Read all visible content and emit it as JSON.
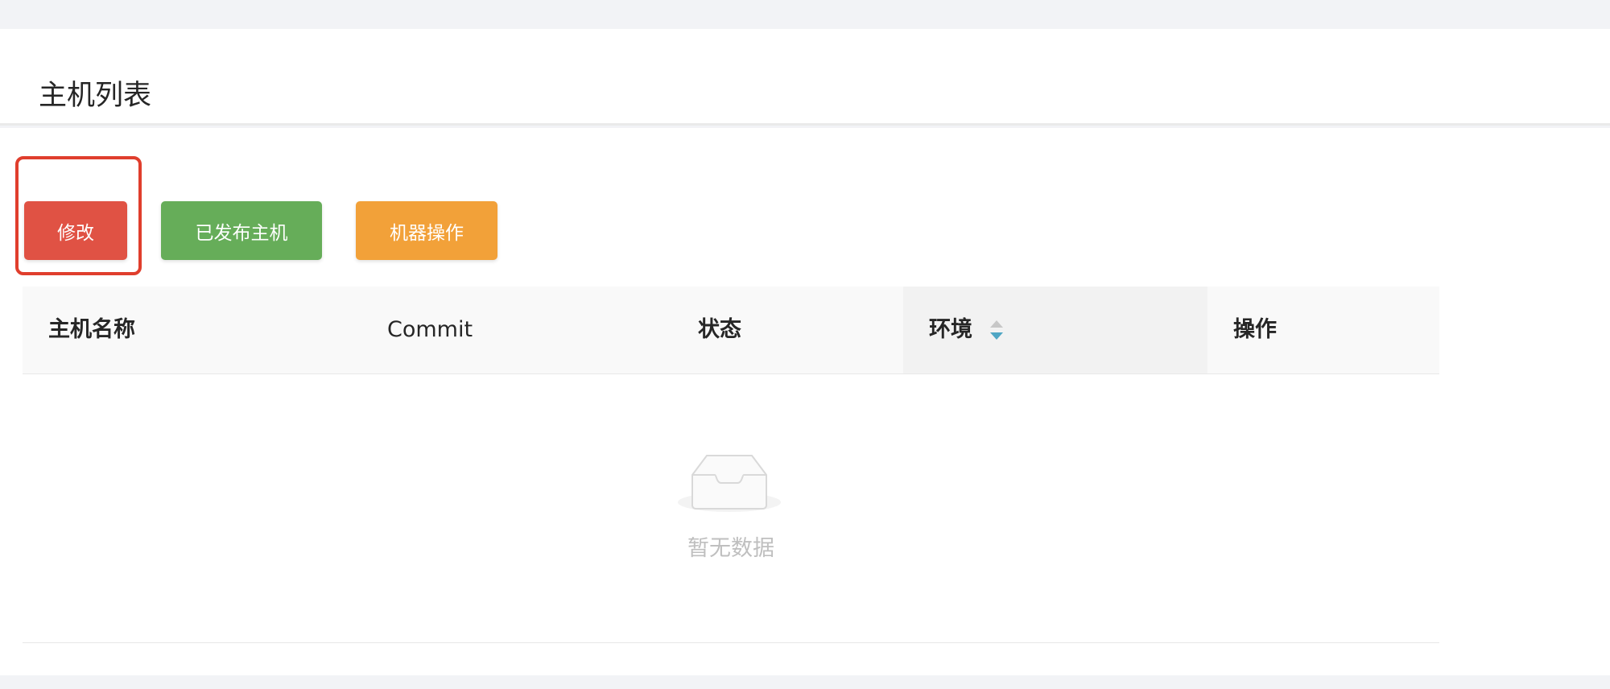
{
  "page": {
    "title": "主机列表"
  },
  "toolbar": {
    "edit_label": "修改",
    "published_hosts_label": "已发布主机",
    "machine_ops_label": "机器操作"
  },
  "table": {
    "columns": [
      {
        "label": "主机名称"
      },
      {
        "label": "Commit"
      },
      {
        "label": "状态"
      },
      {
        "label": "环境",
        "sortable": true
      },
      {
        "label": "操作"
      }
    ],
    "empty_text": "暂无数据"
  },
  "colors": {
    "edit": "#e05244",
    "published": "#66ad59",
    "machine_ops": "#f2a139",
    "highlight": "#e03e2d",
    "sort_active": "#4fa6c4"
  },
  "icons": {
    "sort": "sort-caret-icon",
    "empty": "empty-inbox-icon"
  }
}
